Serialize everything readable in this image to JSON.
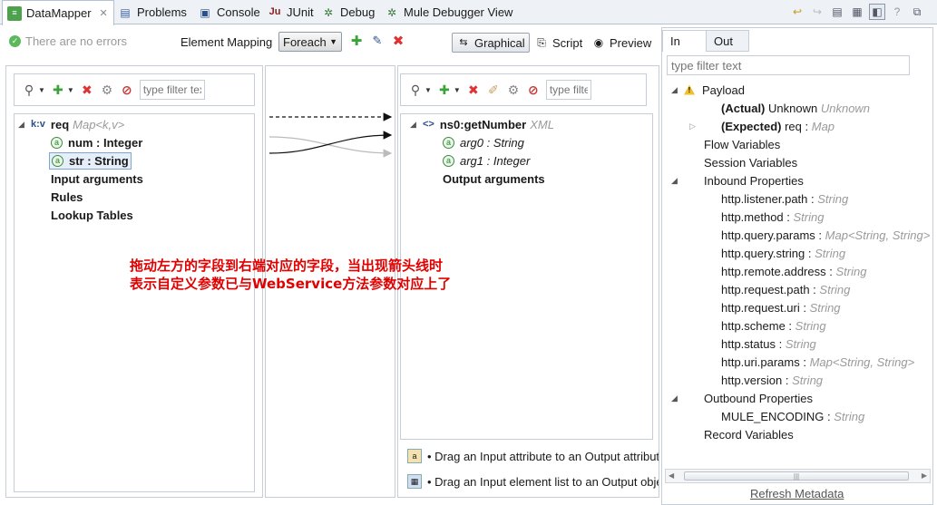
{
  "tabs": [
    {
      "label": "DataMapper",
      "icon": "datamapper-icon",
      "active": true
    },
    {
      "label": "Problems",
      "icon": "problems-icon"
    },
    {
      "label": "Console",
      "icon": "console-icon"
    },
    {
      "label": "JUnit",
      "icon": "junit-icon"
    },
    {
      "label": "Debug",
      "icon": "debug-icon"
    },
    {
      "label": "Mule Debugger View",
      "icon": "mule-debugger-icon"
    }
  ],
  "toolbar": {
    "errors_text": "There are no errors",
    "element_mapping_label": "Element Mapping",
    "mapping_select_value": "Foreach",
    "view_graphical": "Graphical",
    "view_script": "Script",
    "view_preview": "Preview"
  },
  "input_panel": {
    "filter_placeholder": "type filter text",
    "root": {
      "prefix": "k:v",
      "name": "req",
      "type": "Map<k,v>"
    },
    "fields": [
      {
        "label": "num : Integer"
      },
      {
        "label": "str : String"
      }
    ],
    "sections": [
      "Input arguments",
      "Rules",
      "Lookup Tables"
    ]
  },
  "output_panel": {
    "filter_placeholder": "type filter text",
    "root": {
      "prefix": "<>",
      "name": "ns0:getNumber",
      "type": "XML"
    },
    "fields": [
      {
        "label": "arg0 : String"
      },
      {
        "label": "arg1 : Integer"
      }
    ],
    "sections": [
      "Output arguments"
    ],
    "hints": [
      "• Drag an Input attribute to an Output attribute",
      "• Drag an Input element list to an Output object"
    ]
  },
  "annotation": {
    "line1": "拖动左方的字段到右端对应的字段，当出现箭头线时",
    "line2": "表示自定义参数已与WebService方法参数对应上了"
  },
  "metadata_panel": {
    "tab_in": "In",
    "tab_out": "Out",
    "filter_placeholder": "type filter text",
    "payload_label": "Payload",
    "actual": {
      "label": "(Actual)",
      "value": "Unknown",
      "type": "Unknown"
    },
    "expected": {
      "label": "(Expected)",
      "value": "req :",
      "type": "Map"
    },
    "flow_variables": "Flow Variables",
    "session_variables": "Session Variables",
    "inbound_label": "Inbound Properties",
    "inbound": [
      {
        "name": "http.listener.path :",
        "type": "String"
      },
      {
        "name": "http.method :",
        "type": "String"
      },
      {
        "name": "http.query.params :",
        "type": "Map<String, String>"
      },
      {
        "name": "http.query.string :",
        "type": "String"
      },
      {
        "name": "http.remote.address :",
        "type": "String"
      },
      {
        "name": "http.request.path :",
        "type": "String"
      },
      {
        "name": "http.request.uri :",
        "type": "String"
      },
      {
        "name": "http.scheme :",
        "type": "String"
      },
      {
        "name": "http.status :",
        "type": "String"
      },
      {
        "name": "http.uri.params :",
        "type": "Map<String, String>"
      },
      {
        "name": "http.version :",
        "type": "String"
      }
    ],
    "outbound_label": "Outbound Properties",
    "outbound": [
      {
        "name": "MULE_ENCODING :",
        "type": "String"
      }
    ],
    "record_variables": "Record Variables",
    "refresh_label": "Refresh Metadata"
  }
}
